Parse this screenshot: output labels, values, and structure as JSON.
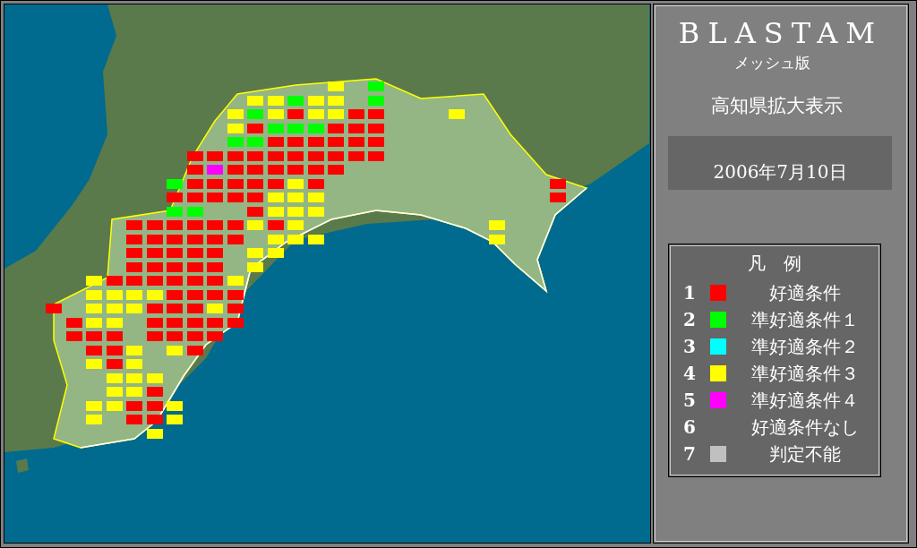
{
  "panel": {
    "title": "BLASTAM",
    "subtitle": "メッシュ版",
    "region_label": "高知県拡大表示",
    "date": "2006年7月10日"
  },
  "legend": {
    "heading": "凡　例",
    "items": [
      {
        "number": "1",
        "label": "好適条件",
        "color": "#ff0000"
      },
      {
        "number": "2",
        "label": "準好適条件１",
        "color": "#00ff00"
      },
      {
        "number": "3",
        "label": "準好適条件２",
        "color": "#00ffff"
      },
      {
        "number": "4",
        "label": "準好適条件３",
        "color": "#ffff00"
      },
      {
        "number": "5",
        "label": "準好適条件４",
        "color": "#ff00ff"
      },
      {
        "number": "6",
        "label": "好適条件なし"
      },
      {
        "number": "7",
        "label": "判定不能",
        "color": "#c0c0c0"
      }
    ]
  },
  "mesh": {
    "rows": [
      {
        "cells": [
          {},
          {},
          {},
          {},
          {},
          {},
          {},
          {},
          {},
          {},
          {},
          {},
          {},
          {},
          {
            "color": "#ffff00"
          },
          {},
          {
            "color": "#00ff00"
          }
        ]
      },
      {
        "cells": [
          {},
          {},
          {},
          {},
          {},
          {},
          {},
          {},
          {},
          {},
          {
            "color": "#ffff00"
          },
          {
            "color": "#ffff00"
          },
          {
            "color": "#00ff00"
          },
          {
            "color": "#ffff00"
          },
          {
            "color": "#ffff00"
          },
          {},
          {
            "color": "#00ff00"
          }
        ]
      },
      {
        "cells": [
          {},
          {},
          {},
          {},
          {},
          {},
          {},
          {},
          {},
          {
            "color": "#ffff00"
          },
          {
            "color": "#00ff00"
          },
          {
            "color": "#ffff00"
          },
          {
            "color": "#ff0000"
          },
          {
            "color": "#ffff00"
          },
          {
            "color": "#ffff00"
          },
          {
            "color": "#ff0000"
          },
          {
            "color": "#ff0000"
          },
          {},
          {},
          {},
          {
            "color": "#ffff00"
          }
        ]
      },
      {
        "cells": [
          {},
          {},
          {},
          {},
          {},
          {},
          {},
          {},
          {},
          {
            "color": "#ffff00"
          },
          {
            "color": "#ff0000"
          },
          {
            "color": "#00ff00"
          },
          {
            "color": "#00ff00"
          },
          {
            "color": "#00ff00"
          },
          {
            "color": "#ff0000"
          },
          {
            "color": "#ff0000"
          },
          {
            "color": "#ff0000"
          }
        ]
      },
      {
        "cells": [
          {},
          {},
          {},
          {},
          {},
          {},
          {},
          {},
          {},
          {
            "color": "#00ff00"
          },
          {
            "color": "#00ff00"
          },
          {
            "color": "#ff0000"
          },
          {
            "color": "#ff0000"
          },
          {
            "color": "#ff0000"
          },
          {
            "color": "#ff0000"
          },
          {
            "color": "#ff0000"
          },
          {
            "color": "#ff0000"
          }
        ]
      },
      {
        "cells": [
          {},
          {},
          {},
          {},
          {},
          {},
          {},
          {
            "color": "#ff0000"
          },
          {
            "color": "#ff0000"
          },
          {
            "color": "#ff0000"
          },
          {
            "color": "#ff0000"
          },
          {
            "color": "#ff0000"
          },
          {
            "color": "#ff0000"
          },
          {
            "color": "#ff0000"
          },
          {
            "color": "#ff0000"
          },
          {
            "color": "#ff0000"
          },
          {
            "color": "#ff0000"
          }
        ]
      },
      {
        "cells": [
          {},
          {},
          {},
          {},
          {},
          {},
          {},
          {
            "color": "#ff0000"
          },
          {
            "color": "#ff00ff"
          },
          {
            "color": "#ff0000"
          },
          {
            "color": "#ff0000"
          },
          {
            "color": "#ff0000"
          },
          {
            "color": "#ff0000"
          },
          {
            "color": "#ff0000"
          },
          {
            "color": "#ff0000"
          }
        ]
      },
      {
        "cells": [
          {},
          {},
          {},
          {},
          {},
          {},
          {
            "color": "#00ff00"
          },
          {
            "color": "#ff0000"
          },
          {
            "color": "#ff0000"
          },
          {
            "color": "#ff0000"
          },
          {
            "color": "#ff0000"
          },
          {
            "color": "#ff0000"
          },
          {
            "color": "#ffff00"
          },
          {
            "color": "#ff0000"
          },
          {},
          {},
          {},
          {},
          {},
          {},
          {},
          {},
          {},
          {},
          {},
          {
            "color": "#ff0000"
          }
        ]
      },
      {
        "cells": [
          {},
          {},
          {},
          {},
          {},
          {},
          {
            "color": "#ff0000"
          },
          {
            "color": "#ff0000"
          },
          {
            "color": "#ff0000"
          },
          {
            "color": "#ff0000"
          },
          {
            "color": "#ff0000"
          },
          {
            "color": "#ffff00"
          },
          {
            "color": "#ffff00"
          },
          {
            "color": "#ffff00"
          },
          {},
          {},
          {},
          {},
          {},
          {},
          {},
          {},
          {},
          {},
          {},
          {
            "color": "#ff0000"
          }
        ]
      },
      {
        "cells": [
          {},
          {},
          {},
          {},
          {},
          {},
          {
            "color": "#00ff00"
          },
          {
            "color": "#00ff00"
          },
          {},
          {},
          {
            "color": "#ff0000"
          },
          {
            "color": "#ffff00"
          },
          {
            "color": "#ffff00"
          },
          {
            "color": "#ffff00"
          }
        ]
      },
      {
        "cells": [
          {},
          {},
          {},
          {},
          {
            "color": "#ff0000"
          },
          {
            "color": "#ff0000"
          },
          {
            "color": "#ff0000"
          },
          {
            "color": "#ff0000"
          },
          {
            "color": "#ff0000"
          },
          {
            "color": "#ff0000"
          },
          {
            "color": "#ffff00"
          },
          {
            "color": "#ff0000"
          },
          {
            "color": "#ffff00"
          },
          {},
          {},
          {},
          {},
          {},
          {},
          {},
          {},
          {},
          {
            "color": "#ffff00"
          }
        ]
      },
      {
        "cells": [
          {},
          {},
          {},
          {},
          {
            "color": "#ff0000"
          },
          {
            "color": "#ff0000"
          },
          {
            "color": "#ff0000"
          },
          {
            "color": "#ff0000"
          },
          {
            "color": "#ff0000"
          },
          {
            "color": "#ff0000"
          },
          {},
          {
            "color": "#ffff00"
          },
          {
            "color": "#ffff00"
          },
          {
            "color": "#ffff00"
          },
          {},
          {},
          {},
          {},
          {},
          {},
          {},
          {},
          {
            "color": "#ffff00"
          }
        ]
      },
      {
        "cells": [
          {},
          {},
          {},
          {},
          {
            "color": "#ff0000"
          },
          {
            "color": "#ff0000"
          },
          {
            "color": "#ff0000"
          },
          {
            "color": "#ff0000"
          },
          {
            "color": "#ff0000"
          },
          {},
          {
            "color": "#ffff00"
          },
          {
            "color": "#ffff00"
          }
        ]
      },
      {
        "cells": [
          {},
          {},
          {},
          {},
          {
            "color": "#ff0000"
          },
          {
            "color": "#ff0000"
          },
          {
            "color": "#ff0000"
          },
          {
            "color": "#ff0000"
          },
          {
            "color": "#ff0000"
          },
          {},
          {
            "color": "#ffff00"
          }
        ]
      },
      {
        "cells": [
          {},
          {},
          {
            "color": "#ffff00"
          },
          {
            "color": "#ff0000"
          },
          {
            "color": "#ff0000"
          },
          {
            "color": "#ff0000"
          },
          {
            "color": "#ff0000"
          },
          {
            "color": "#ff0000"
          },
          {
            "color": "#ff0000"
          },
          {
            "color": "#ffff00"
          }
        ]
      },
      {
        "cells": [
          {},
          {},
          {
            "color": "#ffff00"
          },
          {
            "color": "#ffff00"
          },
          {
            "color": "#ffff00"
          },
          {
            "color": "#ffff00"
          },
          {
            "color": "#ff0000"
          },
          {
            "color": "#ff0000"
          },
          {
            "color": "#ff0000"
          },
          {
            "color": "#ff0000"
          }
        ]
      },
      {
        "cells": [
          {
            "color": "#ff0000"
          },
          {},
          {
            "color": "#ffff00"
          },
          {
            "color": "#ffff00"
          },
          {
            "color": "#ffff00"
          },
          {
            "color": "#ff0000"
          },
          {
            "color": "#ff0000"
          },
          {
            "color": "#ff0000"
          },
          {
            "color": "#ffff00"
          },
          {
            "color": "#ff0000"
          }
        ]
      },
      {
        "cells": [
          {},
          {
            "color": "#ff0000"
          },
          {
            "color": "#ffff00"
          },
          {
            "color": "#ffff00"
          },
          {},
          {
            "color": "#ff0000"
          },
          {
            "color": "#ff0000"
          },
          {
            "color": "#ff0000"
          },
          {
            "color": "#ff0000"
          },
          {
            "color": "#ff0000"
          }
        ]
      },
      {
        "cells": [
          {},
          {
            "color": "#ff0000"
          },
          {
            "color": "#ff0000"
          },
          {
            "color": "#ff0000"
          },
          {},
          {
            "color": "#ff0000"
          },
          {
            "color": "#ff0000"
          },
          {
            "color": "#ff0000"
          },
          {
            "color": "#ff0000"
          }
        ]
      },
      {
        "cells": [
          {},
          {},
          {
            "color": "#ff0000"
          },
          {
            "color": "#ff0000"
          },
          {
            "color": "#ffff00"
          },
          {},
          {
            "color": "#ffff00"
          },
          {
            "color": "#ff0000"
          }
        ]
      },
      {
        "cells": [
          {},
          {},
          {
            "color": "#ffff00"
          },
          {
            "color": "#ff0000"
          },
          {
            "color": "#ffff00"
          }
        ]
      },
      {
        "cells": [
          {},
          {},
          {},
          {
            "color": "#ffff00"
          },
          {
            "color": "#ffff00"
          },
          {
            "color": "#ffff00"
          }
        ]
      },
      {
        "cells": [
          {},
          {},
          {},
          {
            "color": "#ffff00"
          },
          {
            "color": "#ffff00"
          },
          {
            "color": "#ff0000"
          }
        ]
      },
      {
        "cells": [
          {},
          {},
          {
            "color": "#ffff00"
          },
          {
            "color": "#ffff00"
          },
          {
            "color": "#ff0000"
          },
          {
            "color": "#ff0000"
          },
          {
            "color": "#ffff00"
          }
        ]
      },
      {
        "cells": [
          {},
          {},
          {
            "color": "#ffff00"
          },
          {},
          {
            "color": "#ff0000"
          },
          {
            "color": "#ff0000"
          },
          {
            "color": "#ffff00"
          }
        ]
      },
      {
        "cells": [
          {},
          {},
          {},
          {},
          {},
          {
            "color": "#ffff00"
          }
        ]
      }
    ]
  }
}
